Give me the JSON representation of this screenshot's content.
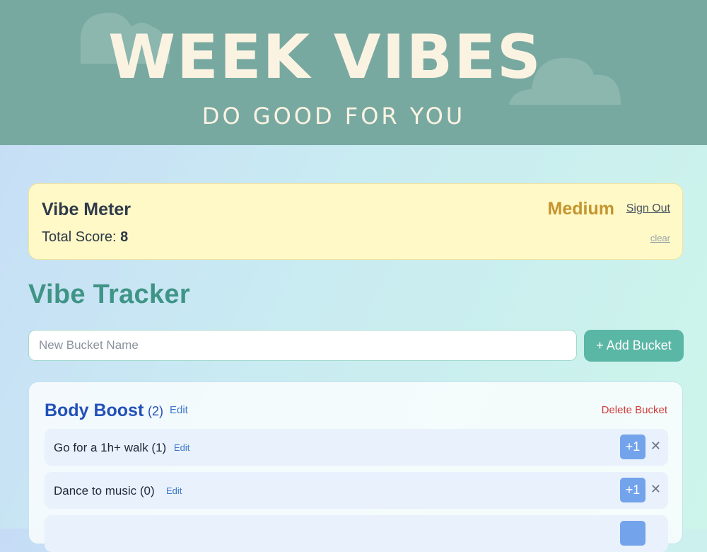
{
  "hero": {
    "title": "WEEK VIBES",
    "subtitle": "DO GOOD FOR YOU"
  },
  "vibe_meter": {
    "title": "Vibe Meter",
    "score_label": "Total Score:",
    "score_value": "8",
    "level": "Medium",
    "sign_out": "Sign Out",
    "clear": "clear"
  },
  "tracker": {
    "title": "Vibe Tracker",
    "new_bucket_placeholder": "New Bucket Name",
    "new_bucket_value": "",
    "add_bucket_label": "+ Add Bucket"
  },
  "buckets": [
    {
      "name": "Body Boost",
      "count": "(2)",
      "edit_label": "Edit",
      "delete_label": "Delete Bucket",
      "items": [
        {
          "label": "Go for a 1h+ walk (1)",
          "edit_label": "Edit",
          "plus_label": "+1",
          "remove_label": "✕"
        },
        {
          "label": "Dance to music (0)",
          "edit_label": "Edit",
          "plus_label": "+1",
          "remove_label": "✕"
        },
        {
          "label": "",
          "edit_label": "",
          "plus_label": "",
          "remove_label": ""
        }
      ]
    }
  ],
  "colors": {
    "hero_bg": "#78a9a1",
    "hero_text": "#fbf3e2",
    "meter_bg": "#fef9c6",
    "level_color": "#c5942f",
    "tracker_title": "#3f9486",
    "accent_button": "#5bb7a5",
    "bucket_title": "#2250b8",
    "delete_color": "#d03c3c",
    "plus_button": "#73a3eb"
  }
}
